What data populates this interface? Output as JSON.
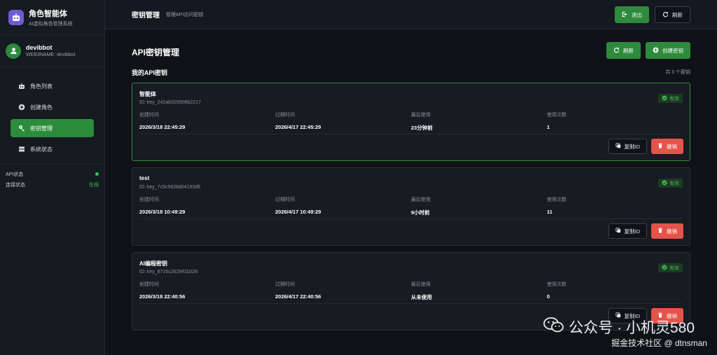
{
  "app": {
    "brand_title": "角色智能体",
    "brand_subtitle": "AI虚拟角色管理系统",
    "brand_color": "#6f5bd6"
  },
  "user": {
    "name": "devibbot",
    "sub": "WEB3NAME: devibbot"
  },
  "sidebar": {
    "items": [
      {
        "label": "角色列表",
        "icon": "robot-icon",
        "active": false
      },
      {
        "label": "创建角色",
        "icon": "plus-circle-icon",
        "active": false
      },
      {
        "label": "密钥管理",
        "icon": "key-icon",
        "active": true
      },
      {
        "label": "系统状态",
        "icon": "server-icon",
        "active": false
      }
    ],
    "status": [
      {
        "label": "API状态",
        "value": ""
      },
      {
        "label": "连接状态",
        "value": "在线"
      }
    ]
  },
  "topbar": {
    "title": "密钥管理",
    "subtitle": "管理API访问密钥",
    "logout_label": "退出",
    "refresh_label": "刷新"
  },
  "page": {
    "title": "API密钥管理",
    "refresh_label": "刷新",
    "create_label": "创建密钥",
    "section_title": "我的API密钥",
    "count_text": "共 3 个密钥"
  },
  "field_labels": {
    "created": "创建时间",
    "expires": "过期时间",
    "last_used": "最后使用",
    "uses": "使用次数"
  },
  "keys": [
    {
      "name": "智能体",
      "id": "ID: key_242ab329908b2217",
      "status": "有效",
      "created": "2026/3/18 22:45:29",
      "expires": "2026/4/17 22:45:29",
      "last_used": "23分钟前",
      "uses": "1",
      "copy_label": "复制ID",
      "revoke_label": "撤销"
    },
    {
      "name": "test",
      "id": "ID: key_7c5c5628d04193d6",
      "status": "有效",
      "created": "2026/3/18 10:49:29",
      "expires": "2026/4/17 10:49:29",
      "last_used": "9小时前",
      "uses": "11",
      "copy_label": "复制ID",
      "revoke_label": "撤销"
    },
    {
      "name": "AI编程密钥",
      "id": "ID: key_8716c262fef1b326",
      "status": "有效",
      "created": "2026/3/18 22:40:56",
      "expires": "2026/4/17 22:40:56",
      "last_used": "从未使用",
      "uses": "0",
      "copy_label": "复制ID",
      "revoke_label": "撤销"
    }
  ],
  "watermark": {
    "line1": "公众号 · 小机灵580",
    "line2": "掘金技术社区 @ dtnsman"
  },
  "colors": {
    "accent_green": "#2e8b3d",
    "danger_red": "#e5534b",
    "status_green": "#3fb950"
  }
}
